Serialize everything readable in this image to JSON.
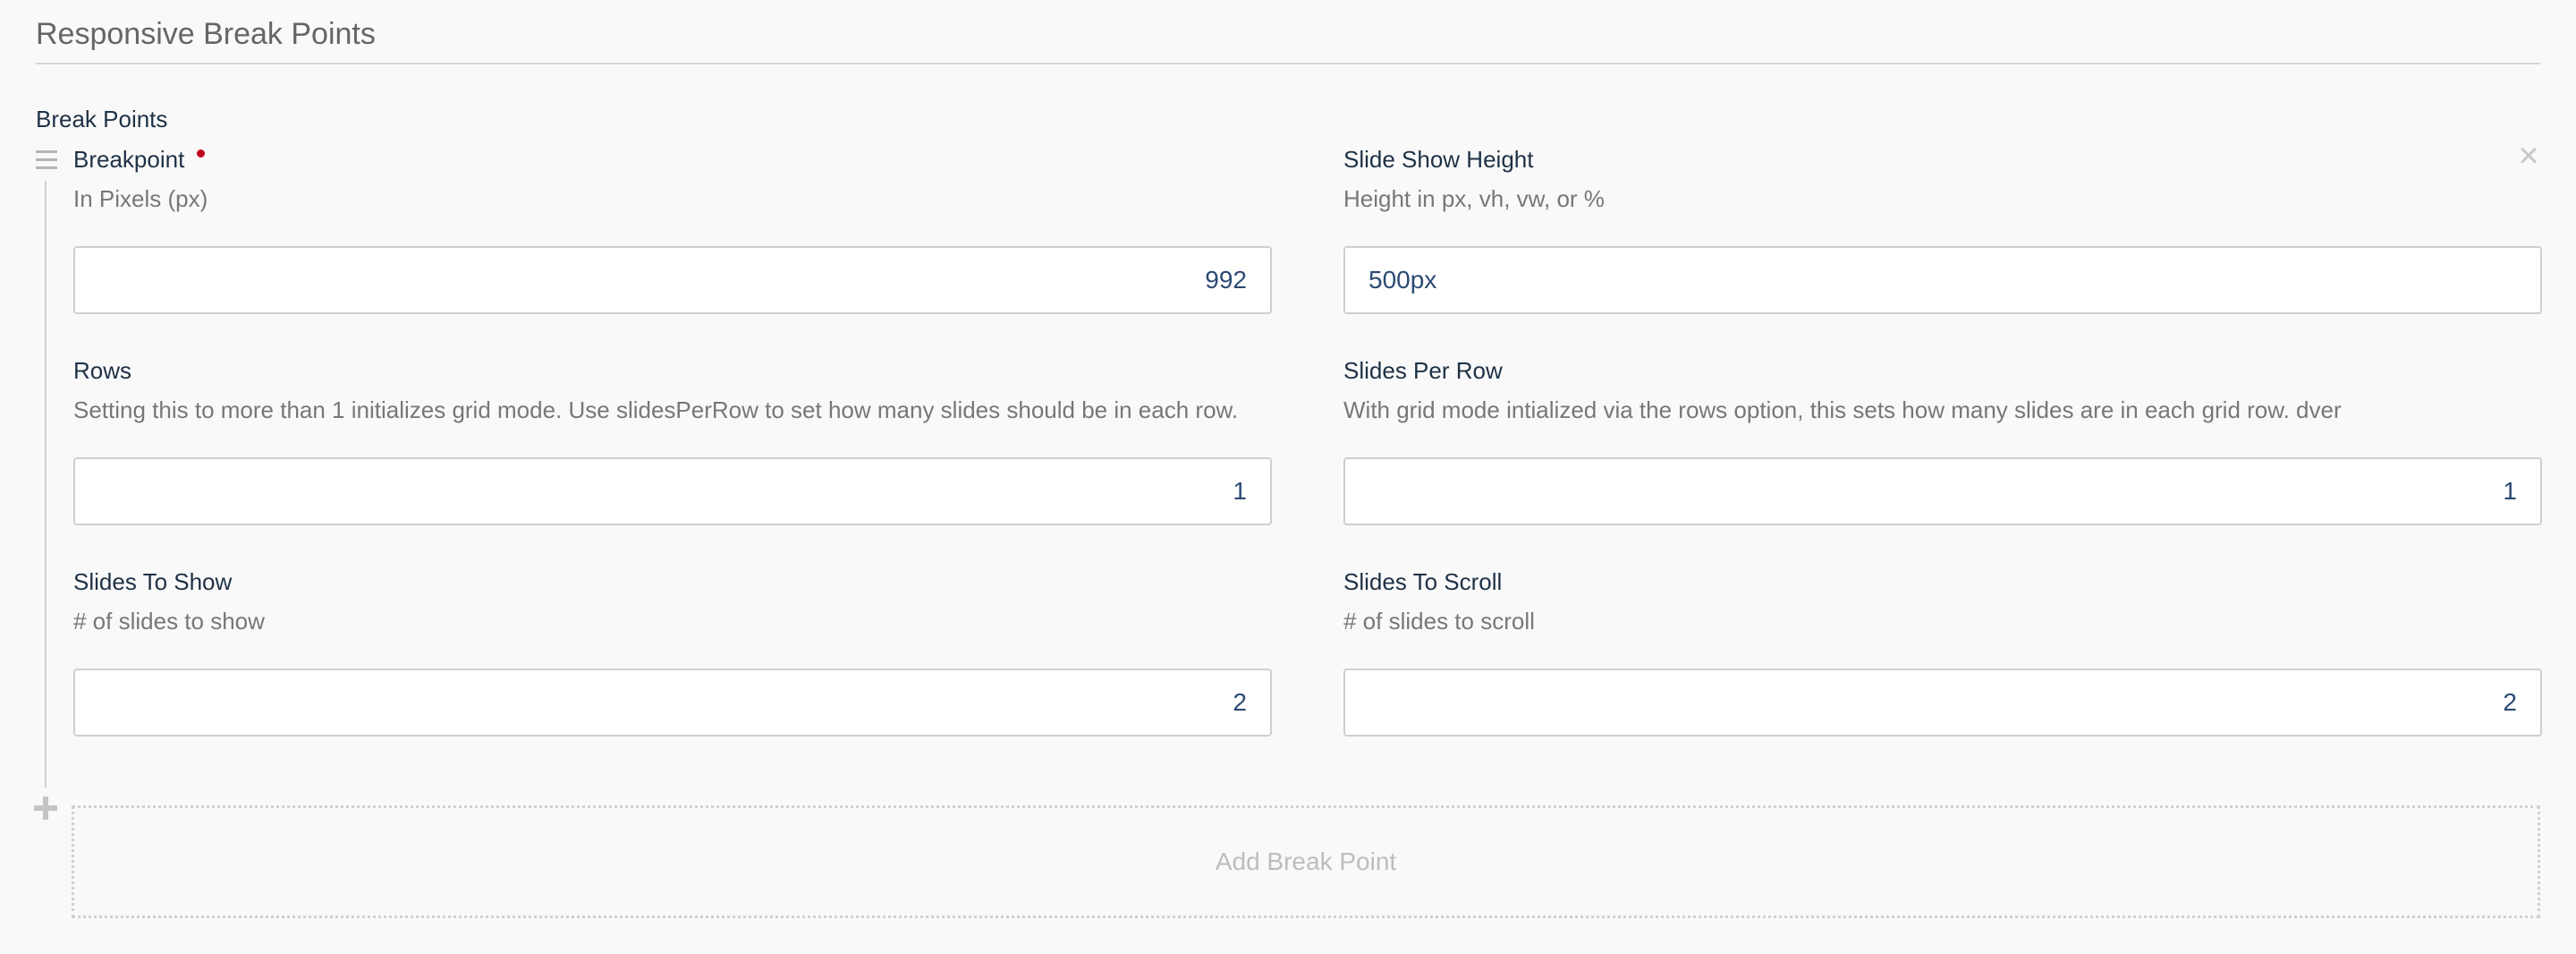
{
  "section": {
    "title": "Responsive Break Points"
  },
  "group": {
    "label": "Break Points"
  },
  "fields": {
    "breakpoint": {
      "label": "Breakpoint",
      "description": "In Pixels (px)",
      "value": "992",
      "required": true
    },
    "slide_show_height": {
      "label": "Slide Show Height",
      "description": "Height in px, vh, vw, or %",
      "value": "500px"
    },
    "rows": {
      "label": "Rows",
      "description": "Setting this to more than 1 initializes grid mode. Use slidesPerRow to set how many slides should be in each row.",
      "value": "1"
    },
    "slides_per_row": {
      "label": "Slides Per Row",
      "description": "With grid mode intialized via the rows option, this sets how many slides are in each grid row. dver",
      "value": "1"
    },
    "slides_to_show": {
      "label": "Slides To Show",
      "description": "# of slides to show",
      "value": "2"
    },
    "slides_to_scroll": {
      "label": "Slides To Scroll",
      "description": "# of slides to scroll",
      "value": "2"
    }
  },
  "actions": {
    "remove_symbol": "×",
    "add_label": "Add Break Point"
  },
  "colors": {
    "accent_text": "#1e3145",
    "input_text": "#2c4a73",
    "required": "#c0001f"
  },
  "icons": {
    "drag": "drag-handle-icon",
    "remove": "close-icon",
    "add": "plus-icon"
  }
}
